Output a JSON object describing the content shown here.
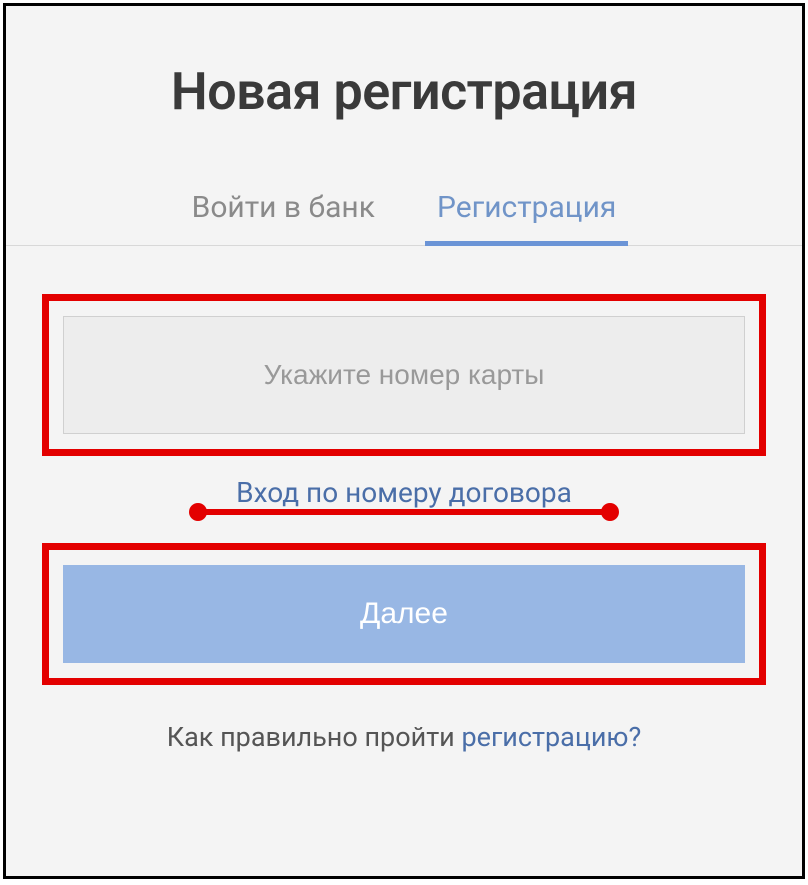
{
  "title": "Новая регистрация",
  "tabs": {
    "login": "Войти в банк",
    "register": "Регистрация"
  },
  "form": {
    "card_placeholder": "Укажите номер карты",
    "contract_link": "Вход по номеру договора",
    "next_button": "Далее"
  },
  "help": {
    "prefix": "Как правильно пройти ",
    "link": "регистрацию?"
  }
}
